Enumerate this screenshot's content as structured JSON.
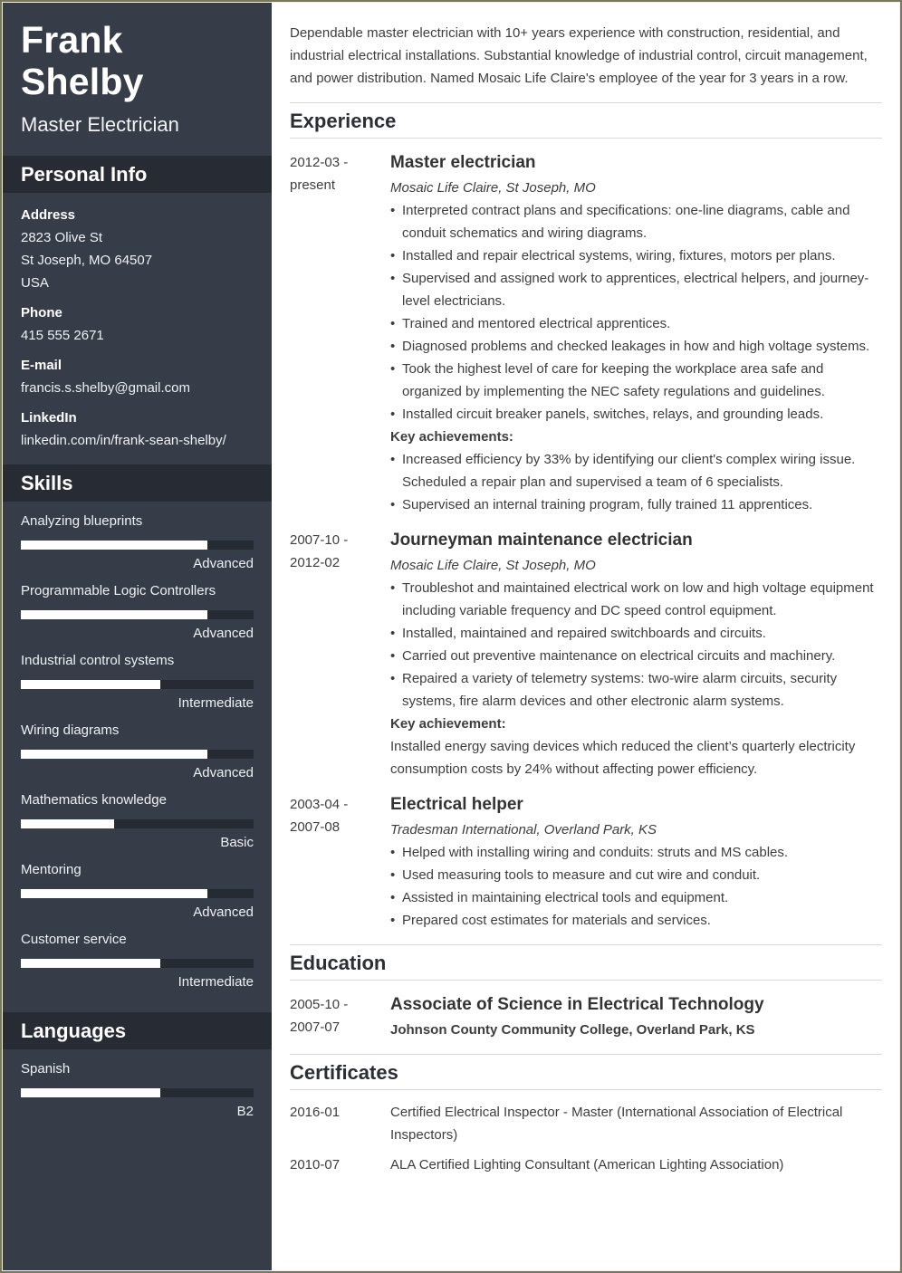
{
  "header": {
    "name": "Frank Shelby",
    "title": "Master Electrician"
  },
  "personal_info": {
    "heading": "Personal Info",
    "address_label": "Address",
    "address_lines": [
      "2823 Olive St",
      "St Joseph, MO 64507",
      "USA"
    ],
    "phone_label": "Phone",
    "phone": "415 555 2671",
    "email_label": "E-mail",
    "email": "francis.s.shelby@gmail.com",
    "linkedin_label": "LinkedIn",
    "linkedin": "linkedin.com/in/frank-sean-shelby/"
  },
  "skills": {
    "heading": "Skills",
    "items": [
      {
        "name": "Analyzing blueprints",
        "level": "Advanced",
        "fill_percent": 80
      },
      {
        "name": "Programmable Logic Controllers",
        "level": "Advanced",
        "fill_percent": 80
      },
      {
        "name": "Industrial control systems",
        "level": "Intermediate",
        "fill_percent": 60
      },
      {
        "name": "Wiring diagrams",
        "level": "Advanced",
        "fill_percent": 80
      },
      {
        "name": "Mathematics knowledge",
        "level": "Basic",
        "fill_percent": 40
      },
      {
        "name": "Mentoring",
        "level": "Advanced",
        "fill_percent": 80
      },
      {
        "name": "Customer service",
        "level": "Intermediate",
        "fill_percent": 60
      }
    ]
  },
  "languages": {
    "heading": "Languages",
    "items": [
      {
        "name": "Spanish",
        "level": "B2",
        "fill_percent": 60
      }
    ]
  },
  "summary": "Dependable master electrician with 10+ years experience with construction, residential, and industrial electrical installations. Substantial knowledge of industrial control, circuit management, and power distribution. Named Mosaic Life Claire's employee of the year for 3 years in a row.",
  "experience": {
    "heading": "Experience",
    "jobs": [
      {
        "date_start": "2012-03 -",
        "date_end": "present",
        "title": "Master electrician",
        "company": "Mosaic Life Claire, St Joseph, MO",
        "bullets": [
          "Interpreted contract plans and specifications: one-line diagrams, cable and conduit schematics and wiring diagrams.",
          "Installed and repair electrical systems, wiring, fixtures, motors per plans.",
          "Supervised and assigned work to apprentices, electrical helpers, and journey-level electricians.",
          "Trained and mentored electrical apprentices.",
          "Diagnosed problems and checked leakages in how and high voltage systems.",
          "Took the highest level of care for keeping the workplace area safe and organized by implementing the NEC safety regulations and guidelines.",
          "Installed circuit breaker panels, switches, relays, and grounding leads."
        ],
        "key_label": "Key achievements:",
        "key_bullets": [
          "Increased efficiency by 33% by identifying our client's complex wiring issue. Scheduled a repair plan and supervised a team of 6 specialists.",
          "Supervised an internal training program, fully trained 11 apprentices."
        ]
      },
      {
        "date_start": "2007-10 -",
        "date_end": "2012-02",
        "title": "Journeyman maintenance electrician",
        "company": "Mosaic Life Claire, St Joseph, MO",
        "bullets": [
          "Troubleshot and maintained electrical work on low and high voltage equipment including variable frequency and DC speed control equipment.",
          "Installed, maintained and repaired switchboards and circuits.",
          "Carried out preventive maintenance on electrical circuits and machinery.",
          "Repaired a variety of telemetry systems: two-wire alarm circuits, security systems, fire alarm devices and other electronic alarm systems."
        ],
        "key_label": "Key achievement:",
        "key_text": "Installed energy saving devices which reduced the client’s quarterly electricity consumption costs by 24% without affecting power efficiency."
      },
      {
        "date_start": "2003-04 -",
        "date_end": "2007-08",
        "title": "Electrical helper",
        "company": "Tradesman International, Overland Park, KS",
        "bullets": [
          "Helped with installing wiring and conduits: struts and MS cables.",
          "Used measuring tools to measure and cut wire and conduit.",
          "Assisted in maintaining electrical tools and equipment.",
          "Prepared cost estimates for materials and services."
        ]
      }
    ]
  },
  "education": {
    "heading": "Education",
    "items": [
      {
        "date_start": "2005-10 -",
        "date_end": "2007-07",
        "degree": "Associate of Science in Electrical Technology",
        "school": "Johnson County Community College, Overland Park, KS"
      }
    ]
  },
  "certificates": {
    "heading": "Certificates",
    "items": [
      {
        "date": "2016-01",
        "name": "Certified Electrical Inspector - Master (International Association of Electrical Inspectors)"
      },
      {
        "date": "2010-07",
        "name": "ALA Certified Lighting Consultant (American Lighting Association)"
      }
    ]
  },
  "colors": {
    "sidebar_bg": "#373d48",
    "sidebar_heading_bg": "#272b33",
    "bar_track": "#262a32",
    "bar_fill": "#ffffff",
    "page_border": "#77775f"
  }
}
